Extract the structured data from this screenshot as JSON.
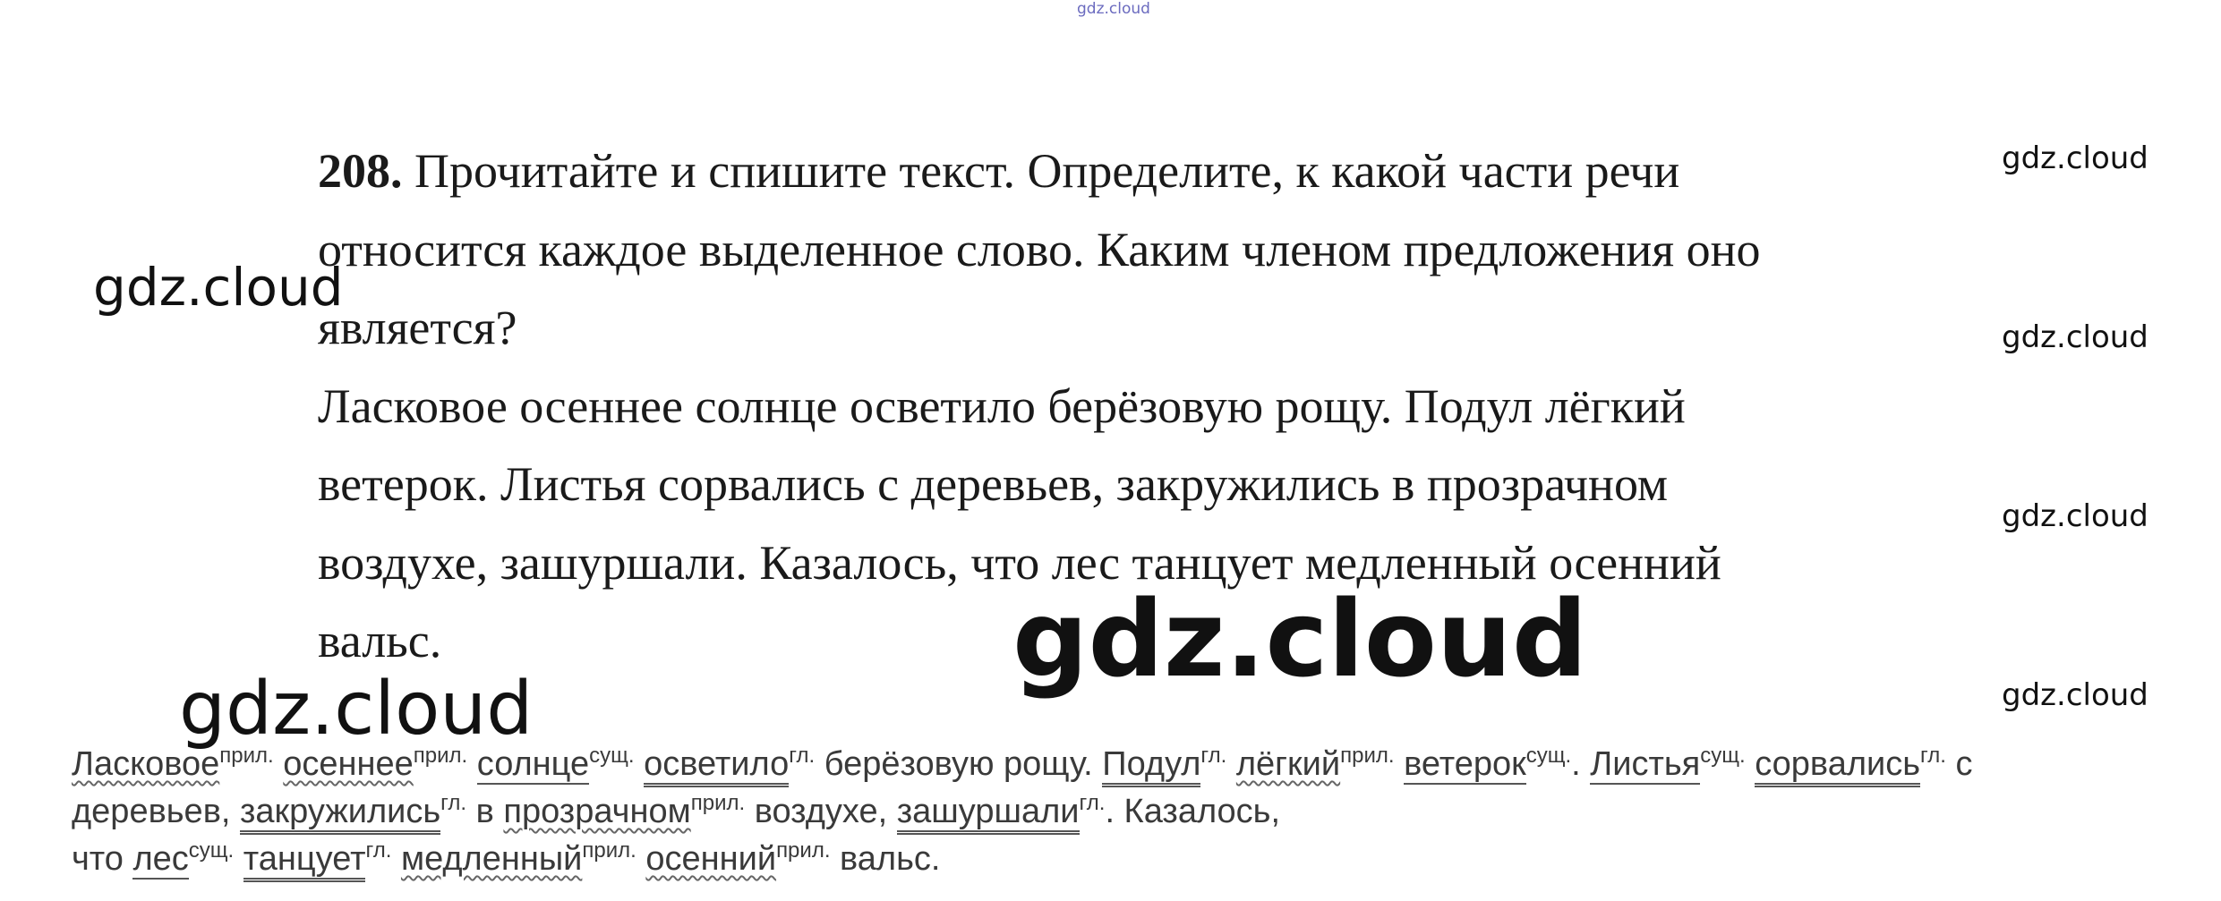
{
  "watermarks": {
    "top": "gdz.cloud",
    "right": [
      "gdz.cloud",
      "gdz.cloud",
      "gdz.cloud",
      "gdz.cloud"
    ],
    "left1": "gdz.cloud",
    "left2": "gdz.cloud",
    "center": "gdz.cloud"
  },
  "task": {
    "number": "208.",
    "lines": [
      " Прочитайте и спишите текст. Определите, к какой части речи",
      "относится каждое выделенное слово. Каким членом предложения оно",
      "является?",
      "Ласковое осеннее солнце осветило берёзовую рощу. Подул лёгкий",
      "ветерок. Листья сорвались с деревьев, закружились в прозрачном",
      "воздухе, зашуршали. Казалось, что лес танцует медленный осенний",
      "вальс."
    ]
  },
  "answer": {
    "lines": [
      [
        {
          "t": "Ласковое",
          "s": "прил.",
          "u": "wavy"
        },
        {
          "t": " "
        },
        {
          "t": "осеннее",
          "s": "прил.",
          "u": "wavy"
        },
        {
          "t": " "
        },
        {
          "t": "солнце",
          "s": "сущ.",
          "u": "single"
        },
        {
          "t": " "
        },
        {
          "t": "осветило",
          "s": "гл.",
          "u": "double"
        },
        {
          "t": " берёзовую рощу. "
        },
        {
          "t": "Подул",
          "s": "гл.",
          "u": "double"
        },
        {
          "t": " "
        },
        {
          "t": "лёгкий",
          "s": "прил.",
          "u": "wavy"
        },
        {
          "t": " "
        },
        {
          "t": "ветерок",
          "s": "сущ.",
          "u": "single"
        },
        {
          "t": ". "
        },
        {
          "t": "Листья",
          "s": "сущ.",
          "u": "single"
        },
        {
          "t": " "
        },
        {
          "t": "сорвались",
          "s": "гл.",
          "u": "double"
        },
        {
          "t": " с"
        }
      ],
      [
        {
          "t": "деревьев, "
        },
        {
          "t": "закружились",
          "s": "гл.",
          "u": "double"
        },
        {
          "t": " в "
        },
        {
          "t": "прозрачном",
          "s": "прил.",
          "u": "wavy"
        },
        {
          "t": " воздухе, "
        },
        {
          "t": "зашуршали",
          "s": "гл.",
          "u": "double"
        },
        {
          "t": ". Казалось,"
        }
      ],
      [
        {
          "t": "что "
        },
        {
          "t": "лес",
          "s": "сущ.",
          "u": "single"
        },
        {
          "t": " "
        },
        {
          "t": "танцует",
          "s": "гл.",
          "u": "double"
        },
        {
          "t": " "
        },
        {
          "t": "медленный",
          "s": "прил.",
          "u": "wavy"
        },
        {
          "t": " "
        },
        {
          "t": "осенний",
          "s": "прил.",
          "u": "wavy"
        },
        {
          "t": " вальс."
        }
      ]
    ]
  }
}
